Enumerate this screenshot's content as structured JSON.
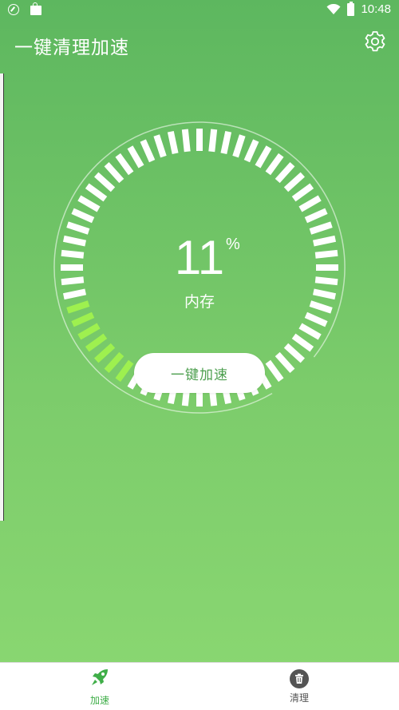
{
  "status_bar": {
    "time": "10:48",
    "left_icons": [
      "compass-icon",
      "bag-icon"
    ],
    "right_icons": [
      "wifi-icon",
      "battery-icon"
    ]
  },
  "app_bar": {
    "title": "一键清理加速",
    "settings_icon": "gear-icon"
  },
  "gauge": {
    "value": "11",
    "unit": "%",
    "label": "内存",
    "fill_fraction": 0.11,
    "active_color": "#9ef04f",
    "inactive_color": "#ffffff"
  },
  "boost_button": {
    "label": "一键加速"
  },
  "bottom_nav": {
    "items": [
      {
        "label": "加速",
        "icon": "rocket-icon",
        "active": true,
        "color": "#3fae48"
      },
      {
        "label": "清理",
        "icon": "trash-icon",
        "active": false,
        "color": "#545454"
      }
    ]
  },
  "colors": {
    "background_top": "#5db75f",
    "background_bottom": "#8bd872",
    "accent": "#3fae48"
  }
}
